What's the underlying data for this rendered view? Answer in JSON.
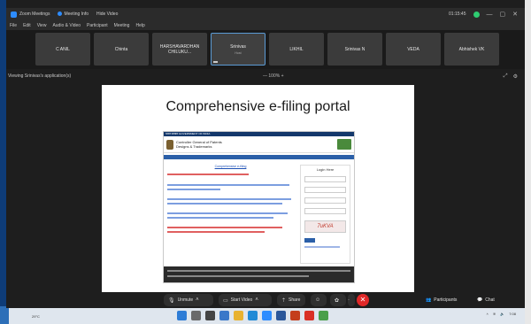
{
  "titlebar": {
    "app_title": "Zoom Meetings",
    "meeting_label": "Meeting Info",
    "view_label": "Hide Video",
    "time": "01:15:45"
  },
  "menubar": [
    "File",
    "Edit",
    "View",
    "Audio & Video",
    "Participant",
    "Meeting",
    "Help"
  ],
  "participants": [
    {
      "name": "C ANIL"
    },
    {
      "name": "Chinta"
    },
    {
      "name": "HARSHAVARDHAN CHILUKU..."
    },
    {
      "name": "Srinivas",
      "sub": "Host"
    },
    {
      "name": "LIKHIL"
    },
    {
      "name": "Srinivas N"
    },
    {
      "name": "VEDA"
    },
    {
      "name": "Abhishek VK"
    }
  ],
  "share": {
    "label": "Viewing Srinivas's application(s)",
    "zoom_label": "— 100% +"
  },
  "slide": {
    "title": "Comprehensive e-filing portal",
    "portal": {
      "top_strip": "भारत सरकार GOVERNMENT OF INDIA",
      "org_line1": "Controller General of Patents",
      "org_line2": "Designs & Trademarks",
      "link": "Comprehensive e-filing",
      "login_title": "Login Here",
      "captcha": "7uKVA"
    }
  },
  "controls": {
    "unmute": "Unmute",
    "start_video": "Start Video",
    "share": "Share",
    "participants": "Participants",
    "chat": "Chat"
  },
  "taskbar": {
    "weather": "29°C",
    "time": "7:08"
  }
}
